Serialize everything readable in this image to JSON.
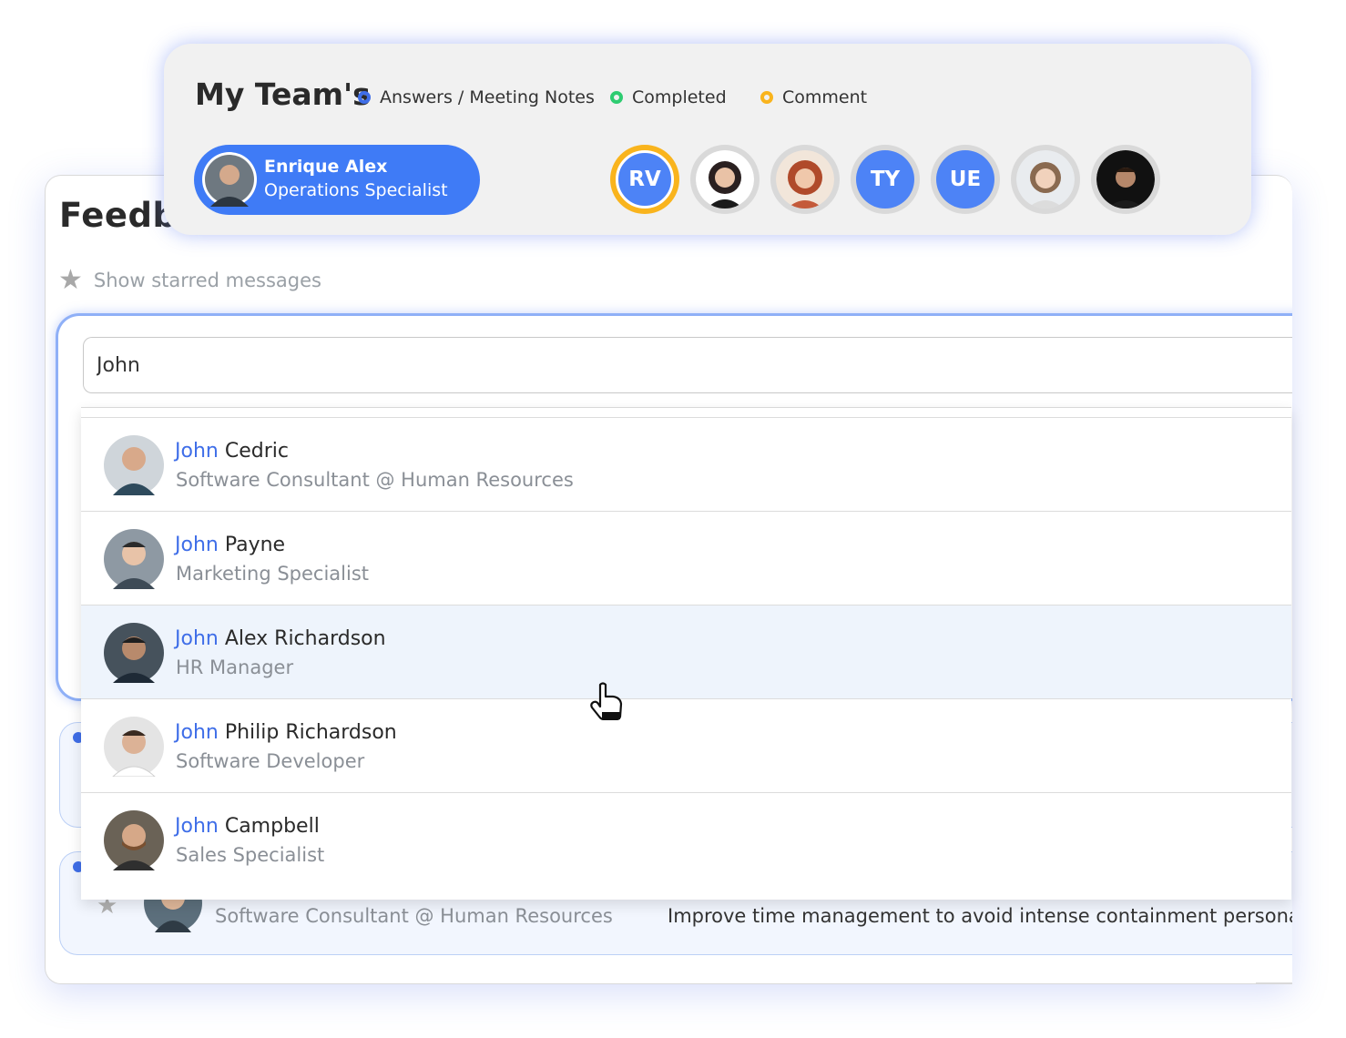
{
  "feedback": {
    "title": "Feedba",
    "starred_label": "Show starred messages",
    "search_value": "John",
    "rows": [
      {
        "role": "",
        "text": ""
      },
      {
        "role": "Software Consultant @ Human Resources",
        "text": "Improve time management to avoid intense containment personal."
      }
    ]
  },
  "dropdown": {
    "items": [
      {
        "match": "John",
        "rest": " Cedric",
        "role": "Software Consultant @ Human Resources"
      },
      {
        "match": "John",
        "rest": " Payne",
        "role": "Marketing Specialist"
      },
      {
        "match": "John",
        "rest": " Alex Richardson",
        "role": "HR Manager",
        "highlighted": true
      },
      {
        "match": "John",
        "rest": " Philip Richardson",
        "role": "Software Developer"
      },
      {
        "match": "John",
        "rest": " Campbell",
        "role": "Sales Specialist"
      }
    ]
  },
  "team": {
    "title": "My Team's",
    "legend": [
      {
        "label": "Answers / Meeting Notes",
        "color": "#3f6ee8"
      },
      {
        "label": "Completed",
        "color": "#2ecc71"
      },
      {
        "label": "Comment",
        "color": "#f9b41d"
      }
    ],
    "selected": {
      "name": "Enrique Alex",
      "role": "Operations Specialist"
    },
    "members": [
      {
        "initials": "RV",
        "type": "initials",
        "active": true
      },
      {
        "type": "photo"
      },
      {
        "type": "photo"
      },
      {
        "initials": "TY",
        "type": "initials"
      },
      {
        "initials": "UE",
        "type": "initials"
      },
      {
        "type": "photo"
      },
      {
        "type": "photo"
      }
    ]
  },
  "colors": {
    "accent": "#3f7bf6",
    "highlight_bg": "#eef4fc",
    "active_ring": "#f9b41d"
  }
}
